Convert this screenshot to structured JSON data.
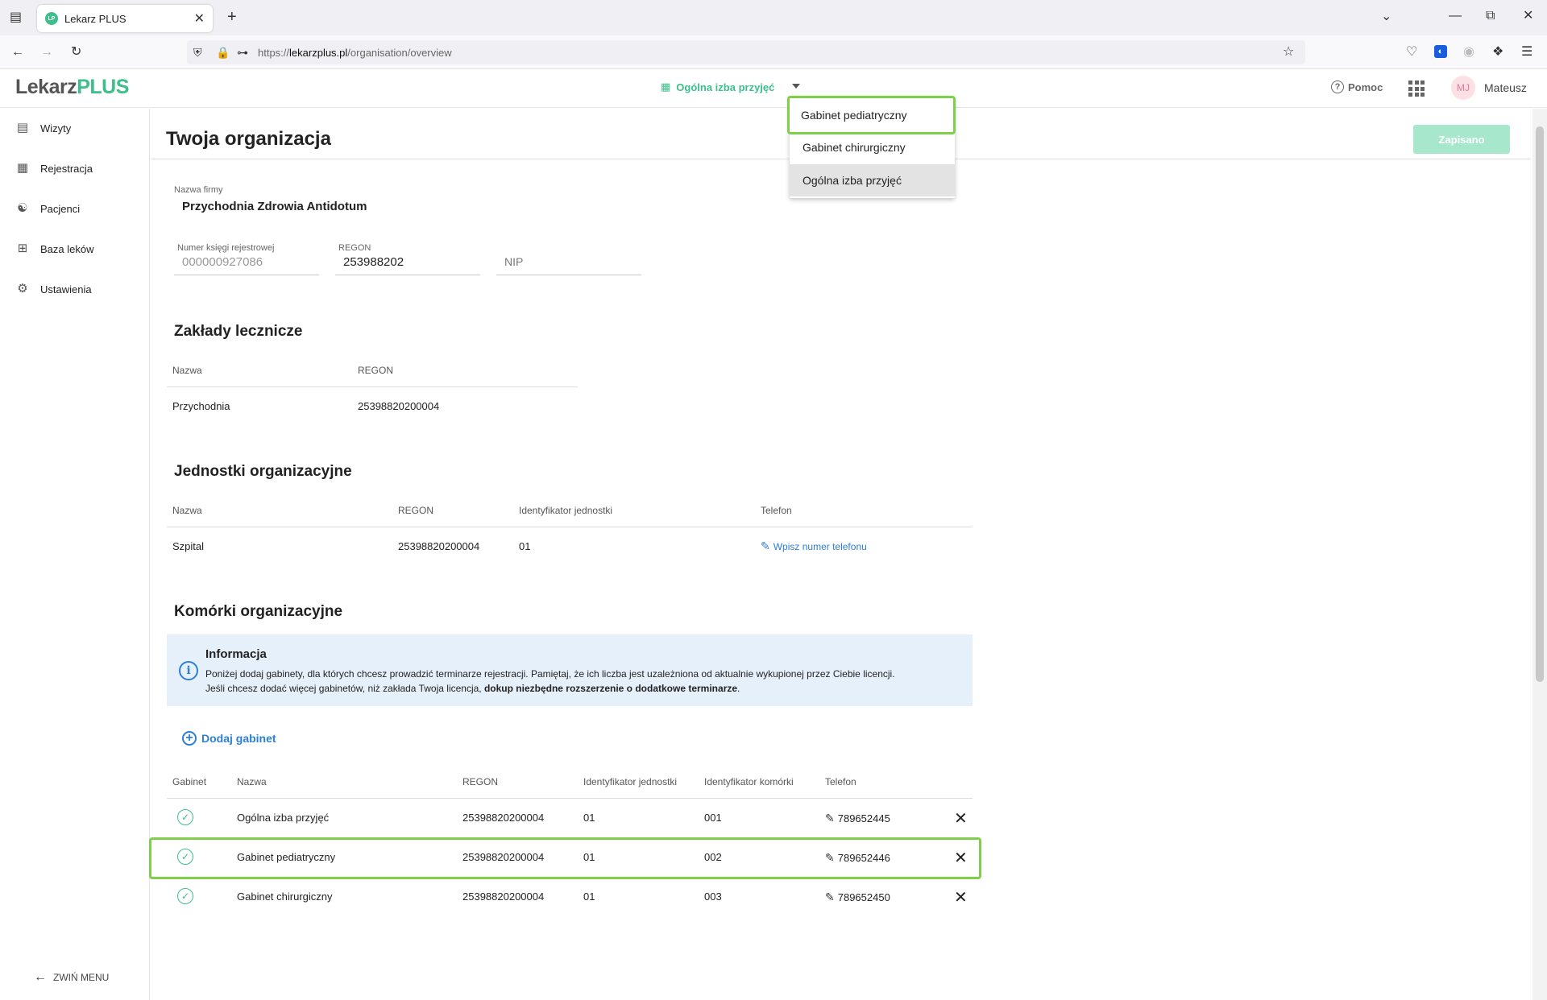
{
  "browser": {
    "tab_title": "Lekarz PLUS",
    "favicon": "LP",
    "url_prefix": "https://",
    "url_domain": "lekarzplus.pl",
    "url_path": "/organisation/overview"
  },
  "header": {
    "logo_main": "Lekarz",
    "logo_plus": "PLUS",
    "selected_unit": "Ogólna izba przyjęć",
    "help_label": "Pomoc",
    "avatar_initials": "MJ",
    "user_name": "Mateusz"
  },
  "dropdown": {
    "items": [
      "Gabinet pediatryczny",
      "Gabinet chirurgiczny",
      "Ogólna izba przyjęć"
    ]
  },
  "sidebar": {
    "items": [
      {
        "label": "Wizyty"
      },
      {
        "label": "Rejestracja"
      },
      {
        "label": "Pacjenci"
      },
      {
        "label": "Baza leków"
      },
      {
        "label": "Ustawienia"
      }
    ],
    "collapse_label": "ZWIŃ MENU"
  },
  "page": {
    "title": "Twoja organizacja",
    "saved_label": "Zapisano"
  },
  "company": {
    "name_label": "Nazwa firmy",
    "name_value": "Przychodnia Zdrowia Antidotum",
    "register_label": "Numer księgi rejestrowej",
    "register_value": "000000927086",
    "regon_label": "REGON",
    "regon_value": "253988202",
    "nip_placeholder": "NIP"
  },
  "facilities": {
    "title": "Zakłady lecznicze",
    "headers": [
      "Nazwa",
      "REGON"
    ],
    "rows": [
      [
        "Przychodnia",
        "25398820200004"
      ]
    ]
  },
  "units": {
    "title": "Jednostki organizacyjne",
    "headers": [
      "Nazwa",
      "REGON",
      "Identyfikator jednostki",
      "Telefon"
    ],
    "rows": [
      {
        "name": "Szpital",
        "regon": "25398820200004",
        "id": "01",
        "phone": "Wpisz numer telefonu"
      }
    ]
  },
  "cells": {
    "title": "Komórki organizacyjne",
    "info_title": "Informacja",
    "info_line1": "Poniżej dodaj gabinety, dla których chcesz prowadzić terminarze rejestracji. Pamiętaj, że ich liczba jest uzależniona od aktualnie wykupionej przez Ciebie licencji.",
    "info_line2_start": "Jeśli chcesz dodać więcej gabinetów, niż zakłada Twoja licencja, ",
    "info_line2_bold": "dokup niezbędne rozszerzenie o dodatkowe terminarze",
    "info_line2_end": ".",
    "add_label": "Dodaj gabinet",
    "headers": [
      "Gabinet",
      "Nazwa",
      "REGON",
      "Identyfikator jednostki",
      "Identyfikator komórki",
      "Telefon"
    ],
    "rows": [
      {
        "name": "Ogólna izba przyjęć",
        "regon": "25398820200004",
        "unit_id": "01",
        "cell_id": "001",
        "phone": "789652445"
      },
      {
        "name": "Gabinet pediatryczny",
        "regon": "25398820200004",
        "unit_id": "01",
        "cell_id": "002",
        "phone": "789652446"
      },
      {
        "name": "Gabinet chirurgiczny",
        "regon": "25398820200004",
        "unit_id": "01",
        "cell_id": "003",
        "phone": "789652450"
      }
    ]
  },
  "colors": {
    "brand_green": "#3cbf8a",
    "link_blue": "#2d7fd6",
    "highlight_green": "#7ed04b"
  }
}
